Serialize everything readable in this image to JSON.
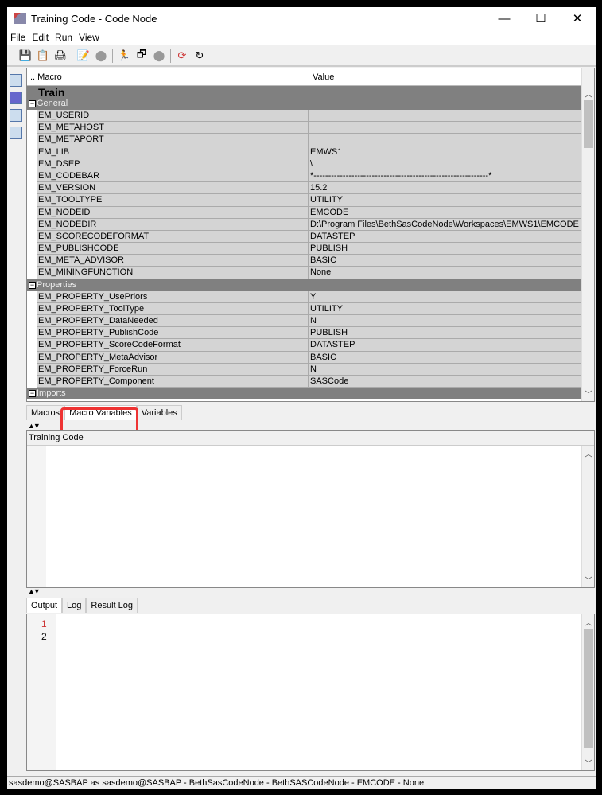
{
  "window": {
    "title": "Training Code - Code Node",
    "minimize": "—",
    "maximize": "☐",
    "close": "✕"
  },
  "menu": [
    "File",
    "Edit",
    "Run",
    "View"
  ],
  "toolbar_icons": [
    "save-icon",
    "copy-icon",
    "print-icon",
    "edit-icon",
    "stop-icon",
    "run-icon",
    "run-node-icon",
    "stop-node-icon",
    "refresh-icon",
    "reload-icon"
  ],
  "table": {
    "col_macro": ".. Macro",
    "col_value": "Value",
    "section": "Train",
    "groups": [
      {
        "name": "General",
        "rows": [
          [
            "EM_USERID",
            ""
          ],
          [
            "EM_METAHOST",
            ""
          ],
          [
            "EM_METAPORT",
            ""
          ],
          [
            "EM_LIB",
            "EMWS1"
          ],
          [
            "EM_DSEP",
            "\\"
          ],
          [
            "EM_CODEBAR",
            "*------------------------------------------------------------*"
          ],
          [
            "EM_VERSION",
            "15.2"
          ],
          [
            "EM_TOOLTYPE",
            "UTILITY"
          ],
          [
            "EM_NODEID",
            "EMCODE"
          ],
          [
            "EM_NODEDIR",
            "D:\\Program Files\\BethSasCodeNode\\Workspaces\\EMWS1\\EMCODE"
          ],
          [
            "EM_SCORECODEFORMAT",
            "DATASTEP"
          ],
          [
            "EM_PUBLISHCODE",
            "PUBLISH"
          ],
          [
            "EM_META_ADVISOR",
            "BASIC"
          ],
          [
            "EM_MININGFUNCTION",
            "None"
          ]
        ]
      },
      {
        "name": "Properties",
        "rows": [
          [
            "EM_PROPERTY_UsePriors",
            "Y"
          ],
          [
            "EM_PROPERTY_ToolType",
            "UTILITY"
          ],
          [
            "EM_PROPERTY_DataNeeded",
            "N"
          ],
          [
            "EM_PROPERTY_PublishCode",
            "PUBLISH"
          ],
          [
            "EM_PROPERTY_ScoreCodeFormat",
            "DATASTEP"
          ],
          [
            "EM_PROPERTY_MetaAdvisor",
            "BASIC"
          ],
          [
            "EM_PROPERTY_ForceRun",
            "N"
          ],
          [
            "EM_PROPERTY_Component",
            "SASCode"
          ]
        ]
      },
      {
        "name": "Imports",
        "rows": []
      }
    ]
  },
  "tabs1": [
    "Macros",
    "Macro Variables",
    "Variables"
  ],
  "code": {
    "label": "Training Code"
  },
  "tabs2": [
    "Output",
    "Log",
    "Result Log"
  ],
  "output": {
    "lines": [
      "1",
      "2"
    ]
  },
  "status": "sasdemo@SASBAP as sasdemo@SASBAP - BethSasCodeNode - BethSASCodeNode - EMCODE - None",
  "colors": {
    "highlight": "#e33333",
    "group": "#808080"
  }
}
